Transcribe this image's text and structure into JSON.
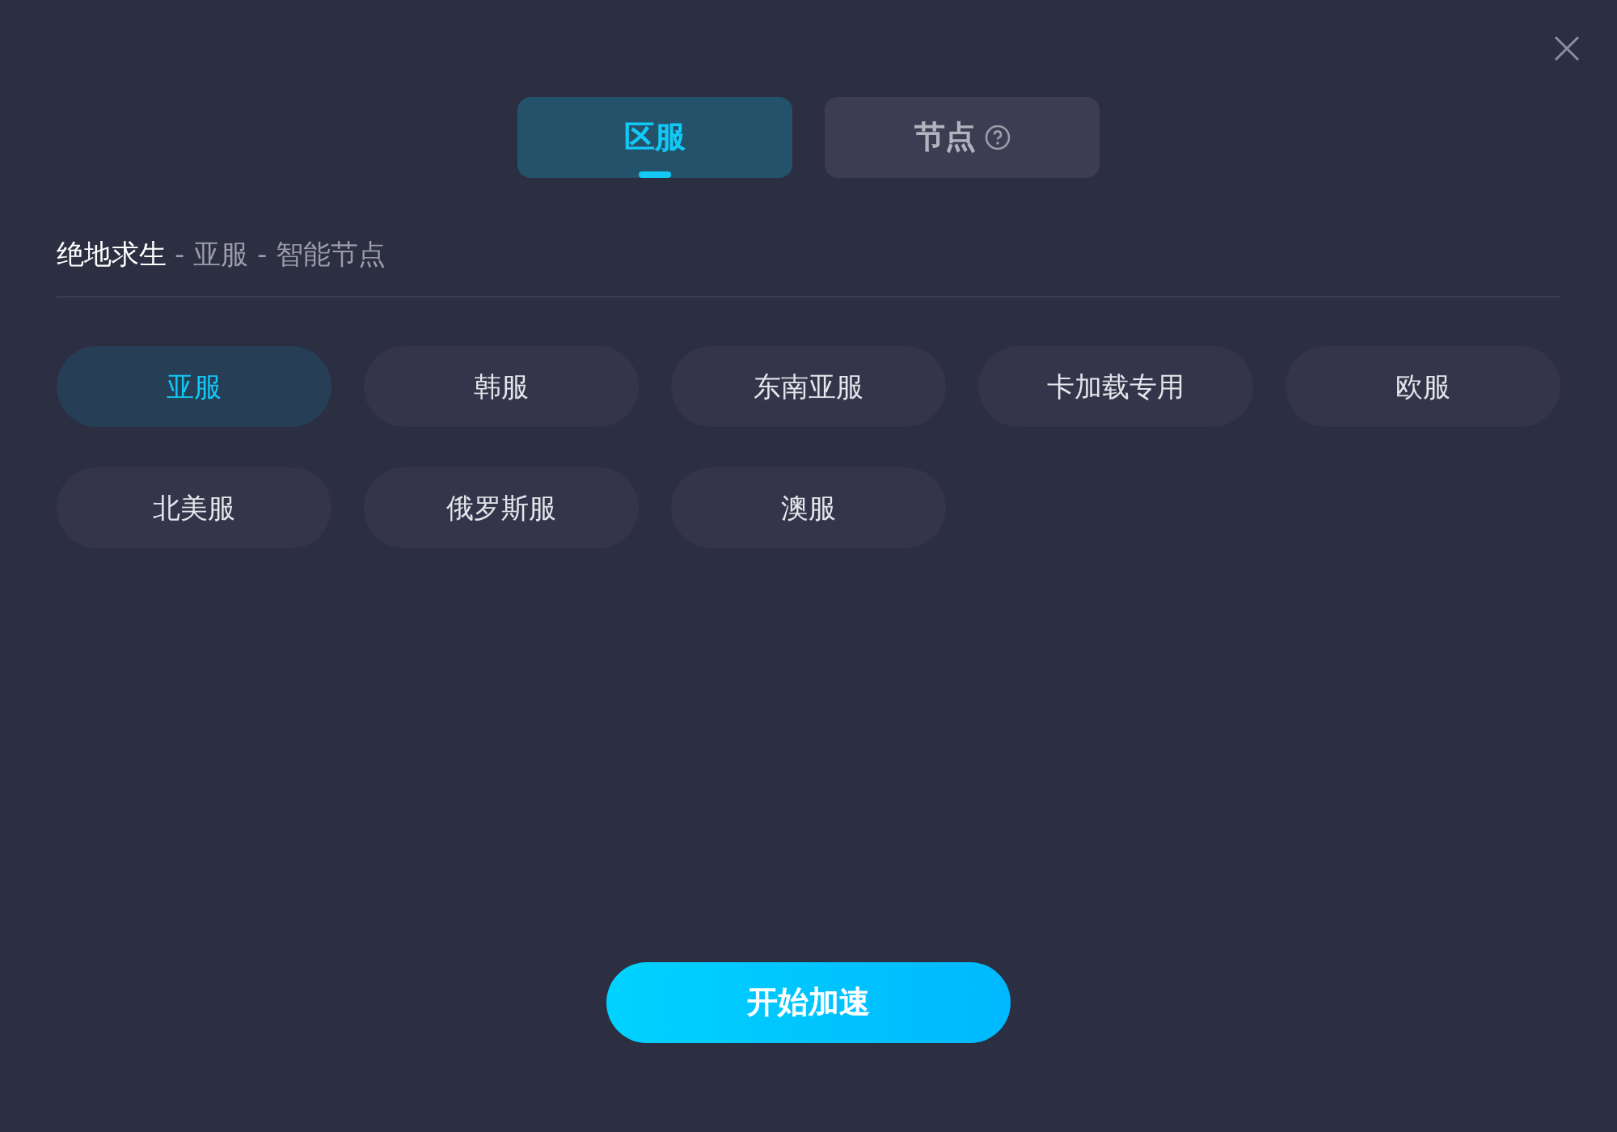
{
  "tabs": [
    {
      "label": "区服",
      "selected": true,
      "help": false
    },
    {
      "label": "节点",
      "selected": false,
      "help": true
    }
  ],
  "breadcrumb": {
    "title": "绝地求生",
    "trail": "- 亚服 - 智能节点"
  },
  "regions": [
    {
      "label": "亚服",
      "selected": true
    },
    {
      "label": "韩服",
      "selected": false
    },
    {
      "label": "东南亚服",
      "selected": false
    },
    {
      "label": "卡加载专用",
      "selected": false
    },
    {
      "label": "欧服",
      "selected": false
    },
    {
      "label": "北美服",
      "selected": false
    },
    {
      "label": "俄罗斯服",
      "selected": false
    },
    {
      "label": "澳服",
      "selected": false
    }
  ],
  "start_button": "开始加速"
}
